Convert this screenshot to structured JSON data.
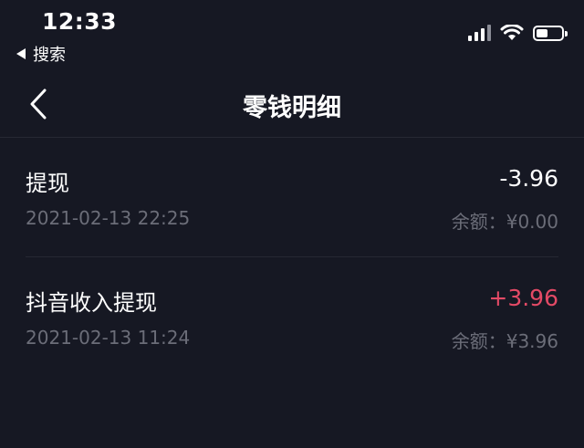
{
  "status_bar": {
    "time": "12:33",
    "back_app_label": "搜索",
    "icons": [
      "cellular-signal-icon",
      "wifi-icon",
      "battery-icon"
    ],
    "battery_level": 0.45
  },
  "nav": {
    "title": "零钱明细",
    "back_icon": "chevron-left-icon"
  },
  "transactions": [
    {
      "title": "提现",
      "date": "2021-02-13 22:25",
      "amount": "-3.96",
      "balance": "余额：¥0.00"
    },
    {
      "title": "抖音收入提现",
      "date": "2021-02-13 11:24",
      "amount": "+3.96",
      "balance": "余额：¥3.96"
    }
  ],
  "colors": {
    "background": "#161823",
    "income": "#e44a66",
    "secondary_text": "#6b6d78",
    "divider": "#262833"
  }
}
